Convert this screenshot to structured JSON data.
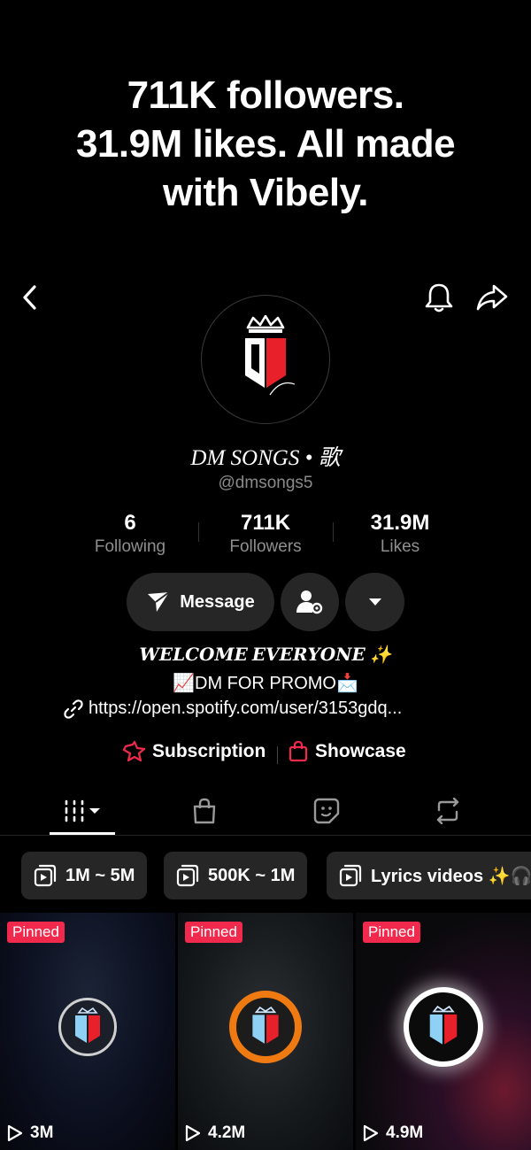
{
  "headline": {
    "line1": "711K followers.",
    "line2": "31.9M likes. All made",
    "line3": "with Vibely."
  },
  "profile": {
    "name": "DM SONGS • 歌",
    "handle": "@dmsongs5",
    "logo_text": "DM"
  },
  "stats": [
    {
      "value": "6",
      "label": "Following"
    },
    {
      "value": "711K",
      "label": "Followers"
    },
    {
      "value": "31.9M",
      "label": "Likes"
    }
  ],
  "actions": {
    "message_label": "Message"
  },
  "bio": {
    "line1": "𝑾𝑬𝑳𝑪𝑶𝑴𝑬 𝑬𝑽𝑬𝑹𝒀𝑶𝑵𝑬 ✨",
    "line2": "📈DM FOR PROMO📩",
    "link": "https://open.spotify.com/user/3153gdq..."
  },
  "links": {
    "subscription": "Subscription",
    "showcase": "Showcase"
  },
  "playlists": [
    {
      "label": "1M ~ 5M"
    },
    {
      "label": "500K ~ 1M"
    },
    {
      "label": "Lyrics videos ✨🎧"
    }
  ],
  "videos": [
    {
      "badge": "Pinned",
      "views": "3M",
      "ring_color": "#cfcfcf"
    },
    {
      "badge": "Pinned",
      "views": "4.2M",
      "ring_color": "#f07a12"
    },
    {
      "badge": "Pinned",
      "views": "4.9M",
      "ring_color": "#ffffff"
    }
  ],
  "colors": {
    "accent_red": "#f0294d",
    "button_bg": "#262626",
    "muted_text": "#8f8f8f"
  }
}
